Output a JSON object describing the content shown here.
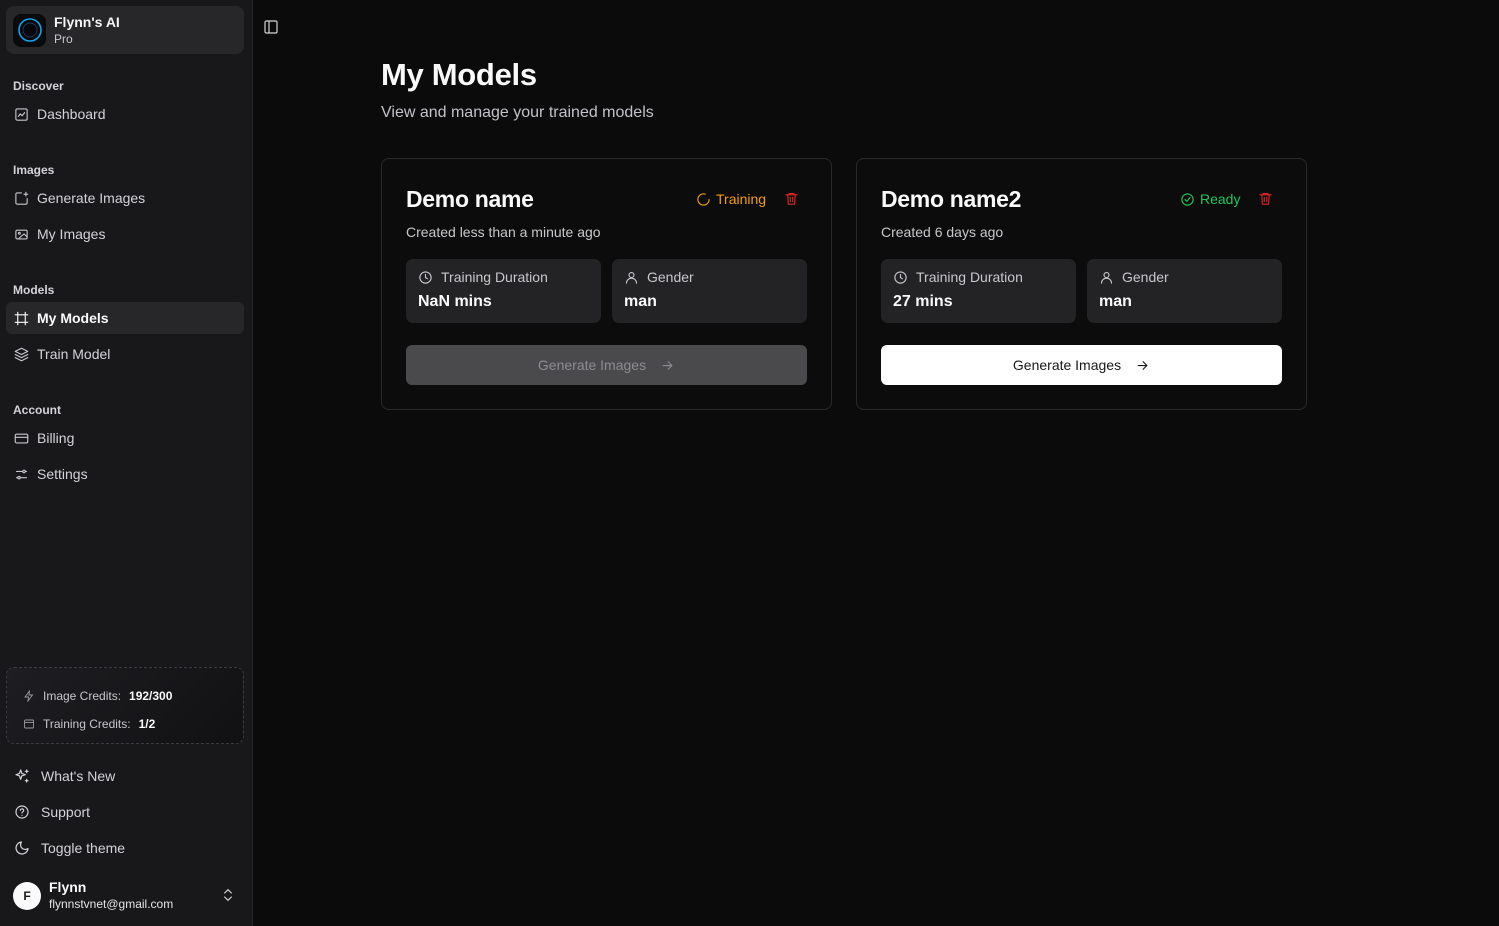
{
  "brand": {
    "title": "Flynn's AI",
    "plan": "Pro"
  },
  "nav": {
    "discover_label": "Discover",
    "dashboard": "Dashboard",
    "images_label": "Images",
    "generate_images": "Generate Images",
    "my_images": "My Images",
    "models_label": "Models",
    "my_models": "My Models",
    "train_model": "Train Model",
    "account_label": "Account",
    "billing": "Billing",
    "settings": "Settings"
  },
  "credits": {
    "image_label": "Image Credits:",
    "image_value": "192/300",
    "training_label": "Training Credits:",
    "training_value": "1/2"
  },
  "footer": {
    "whats_new": "What's New",
    "support": "Support",
    "toggle_theme": "Toggle theme"
  },
  "user": {
    "initial": "F",
    "name": "Flynn",
    "email": "flynnstvnet@gmail.com"
  },
  "page": {
    "title": "My Models",
    "subtitle": "View and manage your trained models"
  },
  "models": [
    {
      "name": "Demo name",
      "status": "Training",
      "created": "Created less than a minute ago",
      "duration_label": "Training Duration",
      "duration_value": "NaN mins",
      "gender_label": "Gender",
      "gender_value": "man",
      "button": "Generate Images",
      "button_enabled": false
    },
    {
      "name": "Demo name2",
      "status": "Ready",
      "created": "Created 6 days ago",
      "duration_label": "Training Duration",
      "duration_value": "27 mins",
      "gender_label": "Gender",
      "gender_value": "man",
      "button": "Generate Images",
      "button_enabled": true
    }
  ],
  "colors": {
    "training_status": "#f59e0b",
    "ready_status": "#22c55e",
    "delete": "#dc2626"
  }
}
